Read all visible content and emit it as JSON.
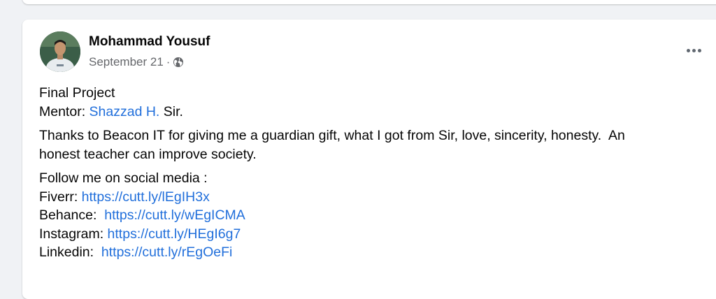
{
  "post": {
    "author": "Mohammad Yousuf",
    "date": "September 21",
    "date_separator": "·",
    "privacy_icon": "globe-icon",
    "more_icon": "more-options-icon",
    "lines": {
      "title": "Final Project",
      "mentor_prefix": "Mentor: ",
      "mentor_name": "Shazzad H.",
      "mentor_suffix": " Sir.",
      "thanks_line1": "Thanks to Beacon IT for giving me a guardian gift, what I got from Sir, love, sincerity, honesty.  An",
      "thanks_line2": "honest teacher can improve society.",
      "follow": "Follow me on social media :"
    },
    "social_links": [
      {
        "label": "Fiverr: ",
        "url": "https://cutt.ly/lEgIH3x"
      },
      {
        "label": "Behance:  ",
        "url": "https://cutt.ly/wEgICMA"
      },
      {
        "label": "Instagram: ",
        "url": "https://cutt.ly/HEgI6g7"
      },
      {
        "label": "Linkedin:  ",
        "url": "https://cutt.ly/rEgOeFi"
      }
    ]
  },
  "colors": {
    "link": "#216fdb",
    "meta": "#65676b",
    "background": "#f0f2f5"
  }
}
